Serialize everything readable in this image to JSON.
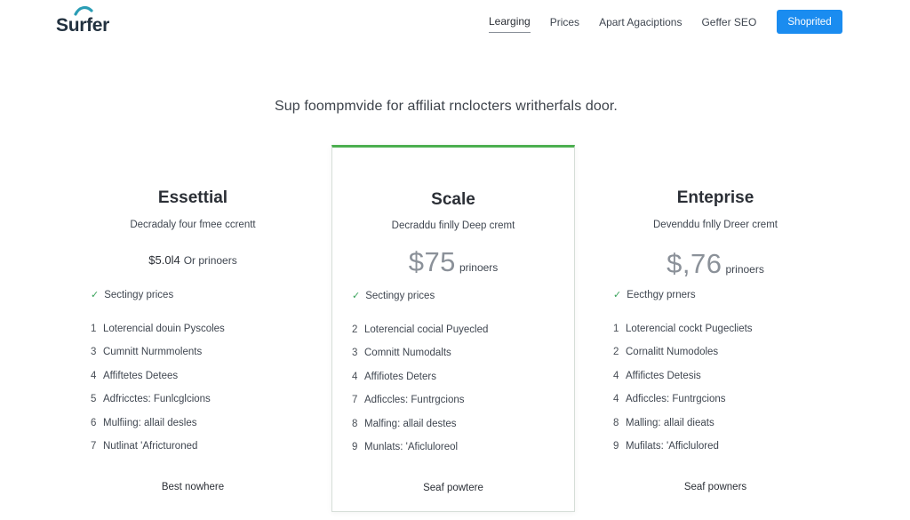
{
  "header": {
    "logo_text": "Surfer",
    "nav": [
      "Learging",
      "Prices",
      "Apart Agaciptions",
      "Geffer SEO"
    ],
    "cta_label": "Shoprited"
  },
  "headline": "Sup foompmvide for affiliat rnclocters writherfals door.",
  "colors": {
    "accent": "#1a8cf0",
    "featured_border": "#4caf50",
    "check": "#3aa35b"
  },
  "plans": [
    {
      "name": "Essettial",
      "description": "Decradaly four fmee ccrentt",
      "price_main": "",
      "price_small": "$5.0l4",
      "price_unit": "Or prinoers",
      "check_label": "Sectingy prices",
      "features": [
        {
          "num": "1",
          "text": "Loterencial douin Pyscoles"
        },
        {
          "num": "3",
          "text": "Cumnitt Nurmmolents"
        },
        {
          "num": "4",
          "text": "Affiftetes Detees"
        },
        {
          "num": "5",
          "text": "Adfricctes: Funlcglcions"
        },
        {
          "num": "6",
          "text": "Mulfiing: allail desles"
        },
        {
          "num": "7",
          "text": "Nutlinat 'Africturoned"
        }
      ],
      "footer": "Best nowhere"
    },
    {
      "name": "Scale",
      "description": "Decraddu finlly Deep cremt",
      "price_main": "$75",
      "price_small": "",
      "price_unit": "prinoers",
      "check_label": "Sectingy prices",
      "features": [
        {
          "num": "2",
          "text": "Loterencial cocial Puyecled"
        },
        {
          "num": "3",
          "text": "Comnitt Numodalts"
        },
        {
          "num": "4",
          "text": "Affifiotes Deters"
        },
        {
          "num": "7",
          "text": "Adficcles: Funtrgcions"
        },
        {
          "num": "8",
          "text": "Malfing: allail destes"
        },
        {
          "num": "9",
          "text": "Munlats: 'Aficluloreol"
        }
      ],
      "footer": "Seaf powtere"
    },
    {
      "name": "Enteprise",
      "description": "Devenddu fnlly Dreer cremt",
      "price_main": "$,76",
      "price_small": "",
      "price_unit": "prinoers",
      "check_label": "Eecthgy prners",
      "features": [
        {
          "num": "1",
          "text": "Loterencial cockt Pugecliets"
        },
        {
          "num": "2",
          "text": "Cornalitt Numodoles"
        },
        {
          "num": "4",
          "text": "Affifictes Detesis"
        },
        {
          "num": "4",
          "text": "Adficcles: Funtrgcions"
        },
        {
          "num": "8",
          "text": "Malling: allail dieats"
        },
        {
          "num": "9",
          "text": "Mufilats: 'Afficlulored"
        }
      ],
      "footer": "Seaf powners"
    }
  ]
}
